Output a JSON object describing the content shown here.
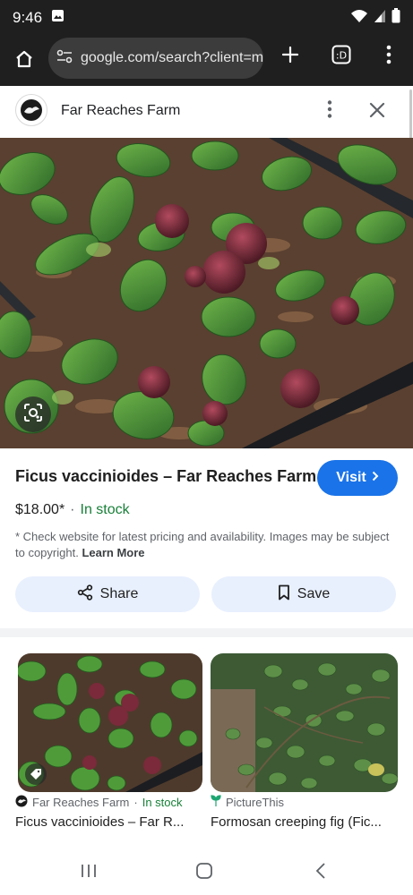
{
  "status_bar": {
    "time": "9:46"
  },
  "browser": {
    "url": "google.com/search?client=ms"
  },
  "panel": {
    "site_name": "Far Reaches Farm"
  },
  "product": {
    "title": "Ficus vaccinioides – Far Reaches Farm",
    "visit_label": "Visit",
    "price": "$18.00*",
    "separator": "·",
    "stock": "In stock",
    "disclaimer": "* Check website for latest pricing and availability. Images may be subject to copyright.",
    "learn_more": "Learn More",
    "share_label": "Share",
    "save_label": "Save"
  },
  "related": [
    {
      "source": "Far Reaches Farm",
      "separator": "·",
      "stock": "In stock",
      "title": "Ficus vaccinioides – Far R..."
    },
    {
      "source": "PictureThis",
      "title": "Formosan creeping fig (Fic..."
    }
  ],
  "colors": {
    "accent": "#1a73e8",
    "stock_green": "#188038",
    "button_tint": "#e8f0fe"
  },
  "icons": [
    "gallery-icon",
    "wifi-icon",
    "signal-icon",
    "battery-icon",
    "home-icon",
    "site-settings-icon",
    "new-tab-icon",
    "tab-switcher-icon",
    "more-vert-icon",
    "close-icon",
    "lens-icon",
    "chevron-right-icon",
    "share-icon",
    "bookmark-icon",
    "tag-icon"
  ]
}
